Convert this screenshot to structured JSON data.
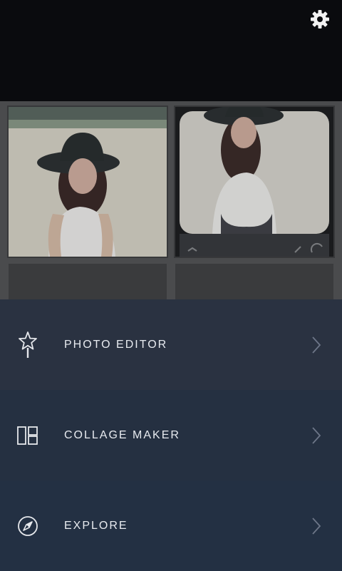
{
  "header": {
    "settings_icon": "gear-icon"
  },
  "colors": {
    "menu_item_1": "#2a3241",
    "menu_item_2": "#253041",
    "menu_item_3": "#233043",
    "label_text": "#e8ebf0",
    "chevron": "#6d7688"
  },
  "menu": {
    "items": [
      {
        "label": "PHOTO EDITOR",
        "icon": "star-wand-icon"
      },
      {
        "label": "COLLAGE MAKER",
        "icon": "collage-grid-icon"
      },
      {
        "label": "EXPLORE",
        "icon": "compass-icon"
      }
    ]
  }
}
